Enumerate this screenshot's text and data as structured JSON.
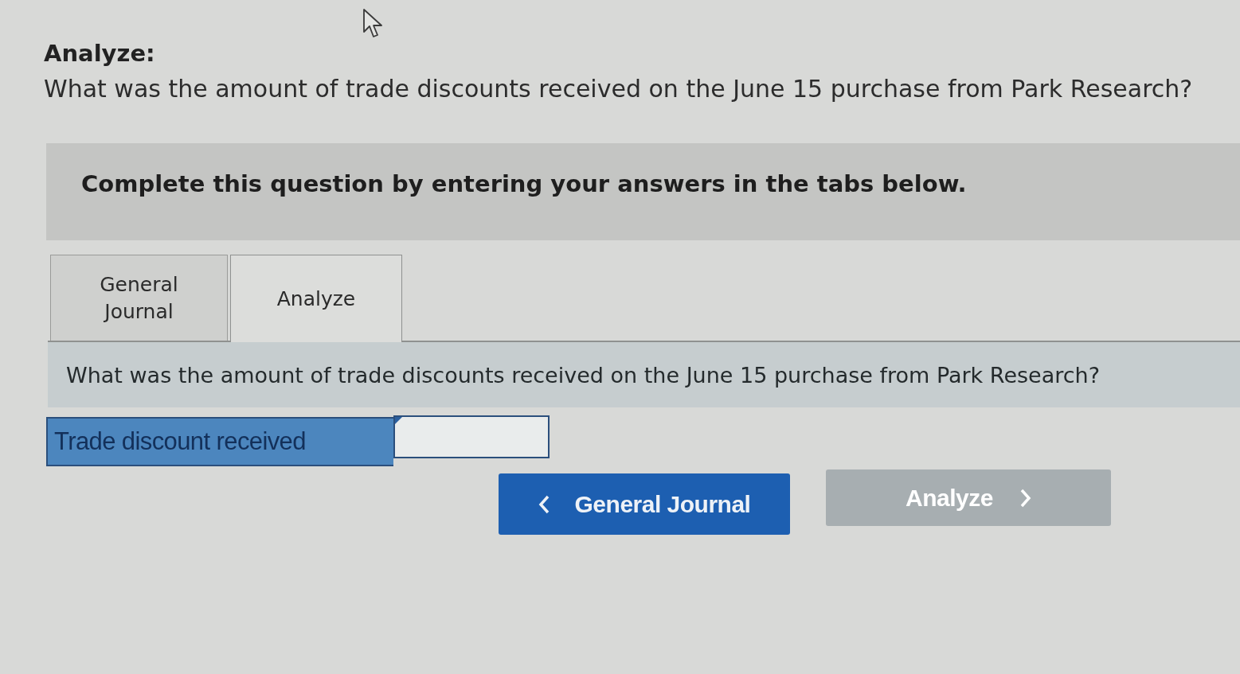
{
  "header": {
    "title": "Analyze:",
    "question": "What was the amount of trade discounts received on the June 15 purchase from Park Research?"
  },
  "instructions": "Complete this question by entering your answers in the tabs below.",
  "tabs": [
    {
      "label": "General Journal",
      "selected": false
    },
    {
      "label": "Analyze",
      "selected": true
    }
  ],
  "panel": {
    "question": "What was the amount of trade discounts received on the June 15 purchase from Park Research?",
    "rows": [
      {
        "label": "Trade discount received"
      }
    ]
  },
  "nav_buttons": [
    {
      "label": "General Journal",
      "kind": "previous",
      "disabled": false
    },
    {
      "label": "Analyze",
      "kind": "next",
      "disabled": true
    }
  ]
}
